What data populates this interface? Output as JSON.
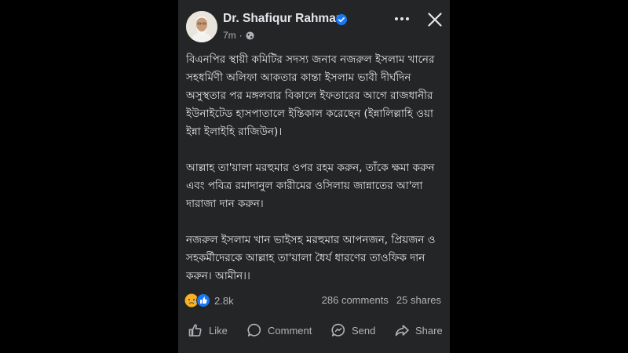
{
  "post": {
    "author": "Dr. Shafiqur Rahman",
    "time": "7m",
    "paragraphs": [
      "বিএনপির স্থায়ী কমিটির সদস্য জনাব নজরুল ইসলাম খানের সহধর্মিণী অলিফা আকতার কান্তা ইসলাম ভাবী দীর্ঘদিন অসুস্থতার পর মঙ্গলবার বিকালে ইফতারের আগে রাজধানীর ইউনাইটেড হাসপাতালে ইন্তিকাল করেছেন (ইন্নালিল্লাহি ওয়া ইন্না ইলাইহি রাজিউন)।",
      "আল্লাহ তা'য়ালা মরহুমার ওপর রহম করুন, তাঁকে ক্ষমা করুন এবং পবিত্র রমাদানুল কারীমের ওসিলায় জান্নাতের আ'লা দারাজা দান করুন।",
      "নজরুল ইসলাম খান ভাইসহ মরহুমার আপনজন, প্রিয়জন ও সহকর্মীদেরকে আল্লাহ তা'য়ালা ধৈর্য ধারণের তাওফিক দান করুন। আমীন।।"
    ],
    "reaction_count": "2.8k",
    "comments": "286 comments",
    "shares": "25 shares"
  },
  "actions": {
    "like": "Like",
    "comment": "Comment",
    "send": "Send",
    "share": "Share"
  },
  "icons": [
    "verified-badge-icon",
    "globe-icon",
    "more-icon",
    "close-icon",
    "sad-reaction-icon",
    "like-reaction-icon",
    "like-icon",
    "comment-icon",
    "send-icon",
    "share-icon"
  ],
  "colors": {
    "background": "#000000",
    "card": "#242526",
    "text": "#e4e6eb",
    "secondary_text": "#b0b3b8",
    "verified_blue": "#1877f2",
    "sad_yellow": "#f7b125"
  }
}
